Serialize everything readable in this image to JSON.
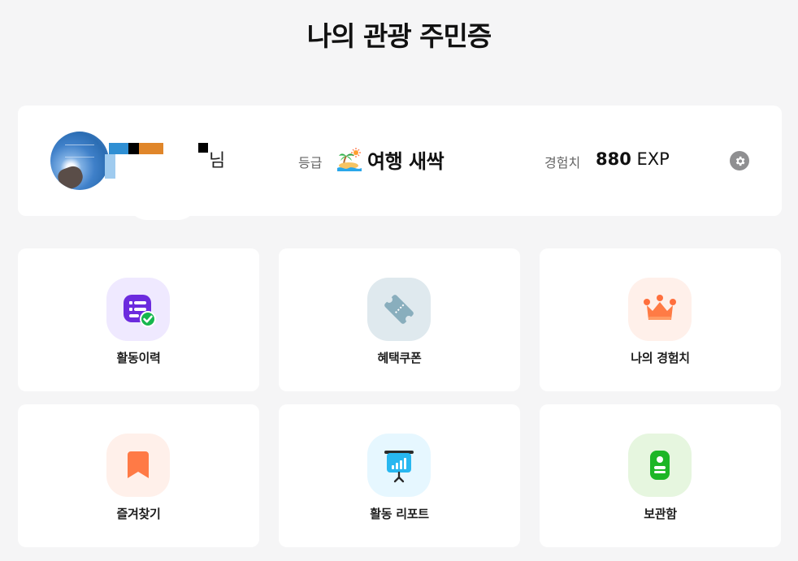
{
  "page": {
    "title": "나의 관광 주민증"
  },
  "profile": {
    "name_suffix": "님",
    "grade_label": "등급",
    "grade_value": "여행 새싹",
    "exp_label": "경험치",
    "exp_value": "880",
    "exp_unit": "EXP",
    "settings_icon": "gear-icon"
  },
  "menu": {
    "items": [
      {
        "label": "활동이력",
        "icon": "activity-history-icon",
        "bg": "#efe9ff"
      },
      {
        "label": "혜택쿠폰",
        "icon": "coupon-ticket-icon",
        "bg": "#dfe9ee"
      },
      {
        "label": "나의 경험치",
        "icon": "crown-icon",
        "bg": "#fff0ea"
      },
      {
        "label": "즐겨찾기",
        "icon": "bookmark-icon",
        "bg": "#fff0ea"
      },
      {
        "label": "활동 리포트",
        "icon": "report-presentation-icon",
        "bg": "#e6f7ff"
      },
      {
        "label": "보관함",
        "icon": "wallet-card-icon",
        "bg": "#e6f6df"
      }
    ]
  }
}
